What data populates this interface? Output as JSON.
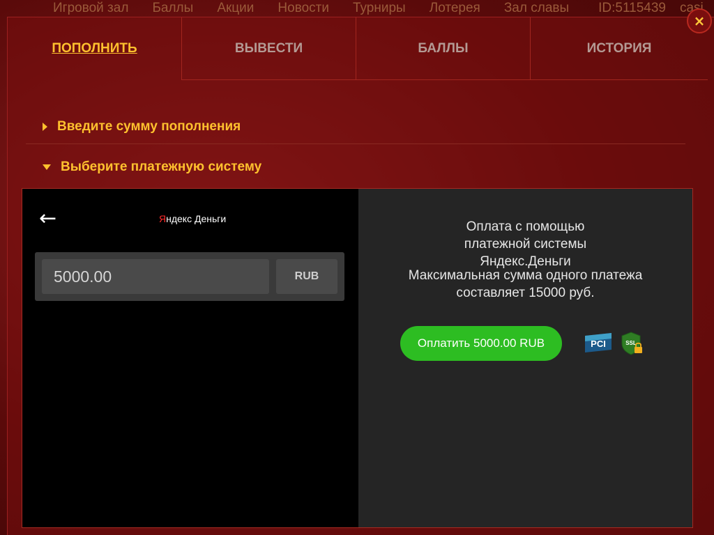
{
  "background_nav": {
    "items": [
      "Игровой зал",
      "Баллы",
      "Акции",
      "Новости",
      "Турниры",
      "Лотерея",
      "Зал славы"
    ],
    "user_id": "ID:5115439",
    "brand_fragment": "casi"
  },
  "modal": {
    "close_label": "×",
    "tabs": [
      {
        "label": "ПОПОЛНИТЬ",
        "active": true
      },
      {
        "label": "ВЫВЕСТИ",
        "active": false
      },
      {
        "label": "БАЛЛЫ",
        "active": false
      },
      {
        "label": "ИСТОРИЯ",
        "active": false
      }
    ],
    "accordion": {
      "amount_section": "Введите сумму пополнения",
      "payment_section": "Выберите платежную систему"
    },
    "payment": {
      "back_label": "←",
      "provider_logo": {
        "prefix": "Я",
        "rest": "ндекс Деньги"
      },
      "amount_value": "5000.00",
      "currency": "RUB",
      "info_line_1": "Оплата с помощью платежной системы Яндекс.Деньги",
      "info_line_2": "Максимальная сумма одного платежа составляет 15000 руб.",
      "pay_button_label": "Оплатить 5000.00 RUB",
      "badges": [
        "PCI",
        "SSL"
      ]
    }
  },
  "colors": {
    "accent": "#ffc12e",
    "pay_button": "#2dbd22",
    "modal_border": "#a52a22"
  }
}
